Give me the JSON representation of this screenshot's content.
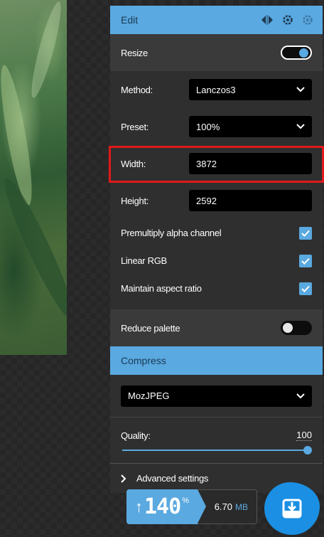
{
  "edit": {
    "title": "Edit",
    "icons": [
      "split-view-icon",
      "settings-gear-icon",
      "settings-gear-dim-icon"
    ]
  },
  "resize": {
    "label": "Resize",
    "enabled": true,
    "method_label": "Method:",
    "method_value": "Lanczos3",
    "preset_label": "Preset:",
    "preset_value": "100%",
    "width_label": "Width:",
    "width_value": "3872",
    "height_label": "Height:",
    "height_value": "2592",
    "options": [
      {
        "label": "Premultiply alpha channel",
        "checked": true
      },
      {
        "label": "Linear RGB",
        "checked": true
      },
      {
        "label": "Maintain aspect ratio",
        "checked": true
      }
    ]
  },
  "reduce_palette": {
    "label": "Reduce palette",
    "enabled": false
  },
  "compress": {
    "title": "Compress",
    "codec": "MozJPEG",
    "quality_label": "Quality:",
    "quality_value": "100",
    "advanced_label": "Advanced settings"
  },
  "result": {
    "arrow": "↑",
    "percent": "140",
    "percent_sign": "%",
    "size_value": "6.70",
    "size_unit": "MB"
  },
  "colors": {
    "accent": "#5aa9e0",
    "highlight_box": "#e0191b",
    "download_button": "#1a8fe3"
  }
}
